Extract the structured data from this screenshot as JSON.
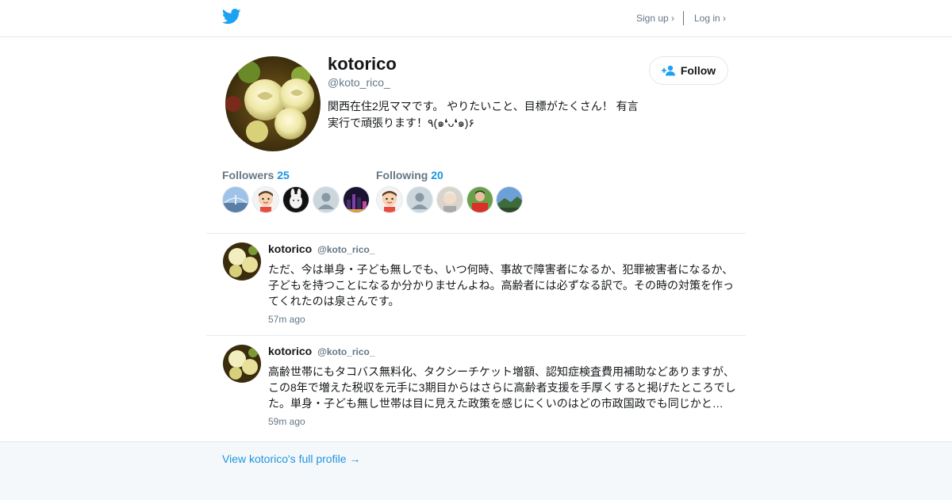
{
  "header": {
    "logo": "twitter-bird-icon",
    "signup_label": "Sign up ›",
    "login_label": "Log in ›"
  },
  "profile": {
    "display_name": "kotorico",
    "handle": "@koto_rico_",
    "bio": "関西在住2児ママです。 やりたいこと、目標がたくさん！ 有言実行で頑張ります！٩(๑❛ᴗ❛๑)۶",
    "follow_label": "Follow",
    "followers_label": "Followers",
    "followers_count": "25",
    "following_label": "Following",
    "following_count": "20",
    "followers_avatars": [
      "bridge-photo",
      "boy-cartoon",
      "rabbit-photo",
      "default-avatar",
      "night-city-photo"
    ],
    "following_avatars": [
      "boy-cartoon",
      "default-avatar",
      "man-portrait",
      "man-red-shirt",
      "landscape-photo"
    ]
  },
  "tweets": [
    {
      "name": "kotorico",
      "handle": "@koto_rico_",
      "text": "ただ、今は単身・子ども無しでも、いつ何時、事故で障害者になるか、犯罪被害者になるか、子どもを持つことになるか分かりませんよね。高齢者には必ずなる訳で。その時の対策を作ってくれたのは泉さんです。",
      "time": "57m ago"
    },
    {
      "name": "kotorico",
      "handle": "@koto_rico_",
      "text": "高齢世帯にもタコバス無料化、タクシーチケット増額、認知症検査費用補助などありますが、この8年で増えた税収を元手に3期目からはさらに高齢者支援を手厚くすると掲げたところでした。単身・子ども無し世帯は目に見えた政策を感じにくいのはどの市政国政でも同じかと…",
      "time": "59m ago"
    }
  ],
  "footer": {
    "link_label": "View kotorico's full profile →"
  },
  "colors": {
    "brand": "#1da1f2",
    "link": "#1b95e0",
    "muted": "#657786",
    "text": "#14171a",
    "footer_bg": "#f5f8fa"
  }
}
